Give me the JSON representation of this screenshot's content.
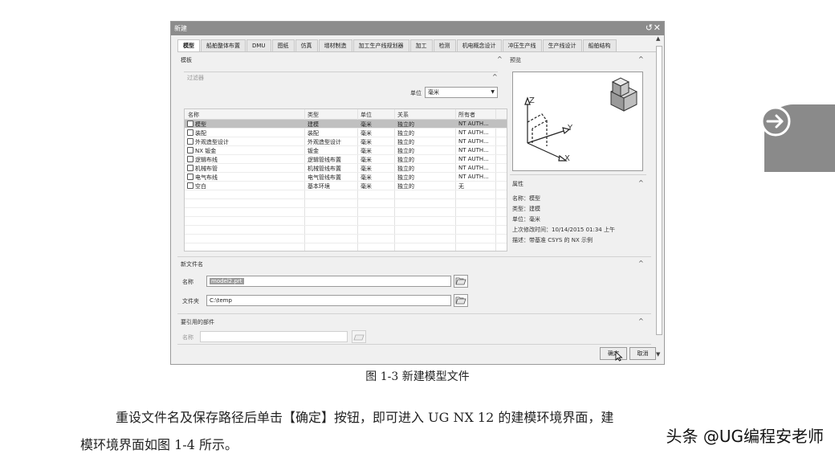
{
  "dialog": {
    "title": "新建",
    "tabs": [
      "模型",
      "船舶整体布置",
      "DMU",
      "图纸",
      "仿真",
      "增材制造",
      "加工生产线规划器",
      "加工",
      "检测",
      "机电概念设计",
      "冲压生产线",
      "生产线设计",
      "船舶结构"
    ],
    "active_tab": "模型",
    "templates_label": "模板",
    "filter_label": "过滤器",
    "unit_label": "单位",
    "unit_value": "毫米",
    "columns": [
      "名称",
      "类型",
      "单位",
      "关系",
      "所有者"
    ],
    "rows": [
      {
        "name": "模型",
        "type": "建模",
        "unit": "毫米",
        "relation": "独立的",
        "owner": "NT AUTH..."
      },
      {
        "name": "装配",
        "type": "装配",
        "unit": "毫米",
        "relation": "独立的",
        "owner": "NT AUTH..."
      },
      {
        "name": "外观造型设计",
        "type": "外观造型设计",
        "unit": "毫米",
        "relation": "独立的",
        "owner": "NT AUTH..."
      },
      {
        "name": "NX 钣金",
        "type": "钣金",
        "unit": "毫米",
        "relation": "独立的",
        "owner": "NT AUTH..."
      },
      {
        "name": "逻辑布线",
        "type": "逻辑管线布置",
        "unit": "毫米",
        "relation": "独立的",
        "owner": "NT AUTH..."
      },
      {
        "name": "机械布管",
        "type": "机械管线布置",
        "unit": "毫米",
        "relation": "独立的",
        "owner": "NT AUTH..."
      },
      {
        "name": "电气布线",
        "type": "电气管线布置",
        "unit": "毫米",
        "relation": "独立的",
        "owner": "NT AUTH..."
      },
      {
        "name": "空白",
        "type": "基本环境",
        "unit": "毫米",
        "relation": "独立的",
        "owner": "无"
      }
    ],
    "preview_label": "预览",
    "axis_z": "Z",
    "axis_y": "Y",
    "axis_x": "X",
    "properties_label": "属性",
    "properties": [
      "名称：模型",
      "类型：建模",
      "单位：毫米",
      "上次修改时间：10/14/2015 01:34 上午",
      "描述：带基准 CSYS 的 NX 示例"
    ],
    "new_file_label": "新文件名",
    "name_label": "名称",
    "name_value": "model2.prt",
    "folder_label": "文件夹",
    "folder_value": "C:\\temp",
    "ref_part_label": "要引用的部件",
    "ref_name_label": "名称",
    "ok_label": "确定",
    "cancel_label": "取消"
  },
  "caption": "图 1-3   新建模型文件",
  "paragraph_line1": "重设文件名及保存路径后单击【确定】按钮，即可进入 UG NX 12 的建模环境界面，建",
  "paragraph_line2": "模环境界面如图 1-4 所示。",
  "watermark": "头条 @UG编程安老师",
  "colors": {
    "dialog_bg": "#f0f0f0",
    "titlebar": "#8c8c8c",
    "selected_row": "#c0c0c0",
    "side_tab": "#8a8a8a"
  }
}
